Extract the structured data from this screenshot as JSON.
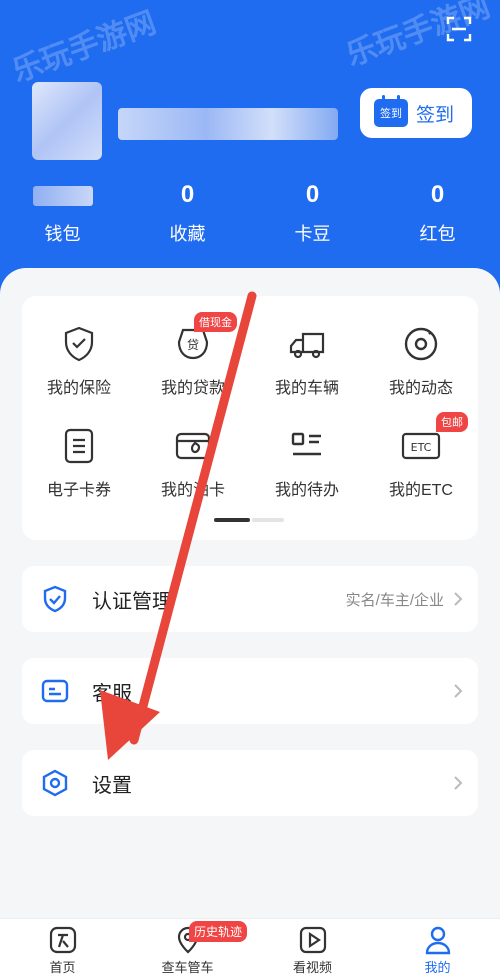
{
  "header": {
    "checkin_label": "签到",
    "checkin_badge": "签到",
    "stats": [
      {
        "value": "",
        "label": "钱包"
      },
      {
        "value": "0",
        "label": "收藏"
      },
      {
        "value": "0",
        "label": "卡豆"
      },
      {
        "value": "0",
        "label": "红包"
      }
    ]
  },
  "grid": {
    "items": [
      {
        "label": "我的保险",
        "icon": "shield-check-icon"
      },
      {
        "label": "我的贷款",
        "icon": "loan-icon",
        "badge": "借现金"
      },
      {
        "label": "我的车辆",
        "icon": "truck-icon"
      },
      {
        "label": "我的动态",
        "icon": "camera-lens-icon"
      },
      {
        "label": "电子卡券",
        "icon": "voucher-icon"
      },
      {
        "label": "我的油卡",
        "icon": "fuel-card-icon"
      },
      {
        "label": "我的待办",
        "icon": "todo-list-icon"
      },
      {
        "label": "我的ETC",
        "icon": "etc-icon",
        "badge": "包邮",
        "etc_text": "ETC"
      }
    ]
  },
  "rows": {
    "auth": {
      "label": "认证管理",
      "sub": "实名/车主/企业"
    },
    "service": {
      "label": "客服"
    },
    "settings": {
      "label": "设置"
    }
  },
  "tabbar": {
    "items": [
      {
        "label": "首页"
      },
      {
        "label": "查车管车",
        "badge": "历史轨迹"
      },
      {
        "label": "看视频"
      },
      {
        "label": "我的"
      }
    ]
  },
  "watermark": "乐玩手游网",
  "colors": {
    "brand": "#1f6cf0",
    "badge": "#f04545",
    "arrow": "#e8463a"
  }
}
